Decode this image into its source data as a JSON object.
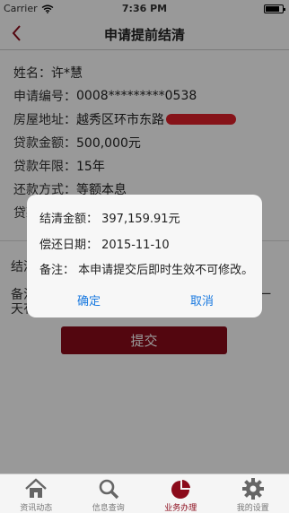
{
  "status_bar": {
    "carrier": "Carrier",
    "time": "7:36 PM",
    "battery_level": 0.85
  },
  "nav": {
    "title": "申请提前结清"
  },
  "form": {
    "name_label": "姓名：",
    "name_value": "许*慧",
    "appno_label": "申请编号：",
    "appno_value": "0008*********0538",
    "address_label": "房屋地址：",
    "address_value": "越秀区环市东路",
    "amount_label": "贷款金额：",
    "amount_value": "500,000元",
    "term_label": "贷款年限：",
    "term_value": "15年",
    "method_label": "还款方式：",
    "method_value": "等额本息",
    "partial_label": "贷款",
    "section_label": "结清",
    "note_line1": "备注",
    "note_line2": "天有",
    "note_tail": "一"
  },
  "submit": {
    "label": "提交"
  },
  "dialog": {
    "amount_line": "结清金额：  397,159.91元",
    "date_line": "偿还日期：  2015-11-10",
    "note_line": "备注：  本申请提交后即时生效不可修改。",
    "confirm_label": "确定",
    "cancel_label": "取消"
  },
  "tabs": [
    {
      "label": "资讯动态",
      "icon": "home-icon"
    },
    {
      "label": "信息查询",
      "icon": "search-icon"
    },
    {
      "label": "业务办理",
      "icon": "pie-chart-icon"
    },
    {
      "label": "我的设置",
      "icon": "gear-icon"
    }
  ],
  "colors": {
    "brand": "#8b0a1a",
    "link": "#1a7ae0",
    "redaction": "#e0202a"
  }
}
